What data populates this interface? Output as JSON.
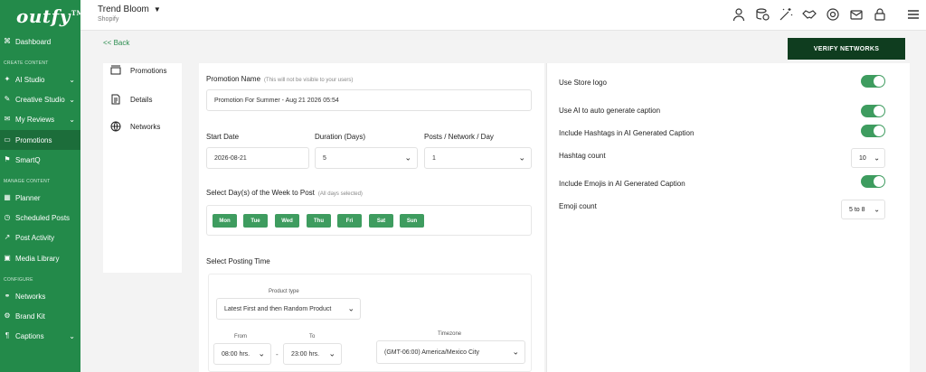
{
  "sidebar": {
    "logo": "outfy",
    "logo_tm": "TM",
    "sections": {
      "create": "CREATE CONTENT",
      "manage": "MANAGE CONTENT",
      "configure": "CONFIGURE"
    },
    "items": [
      {
        "label": "Dashboard",
        "icon": "grid-icon"
      },
      {
        "label": "AI Studio",
        "icon": "ai-icon"
      },
      {
        "label": "Creative Studio",
        "icon": "palette-icon"
      },
      {
        "label": "My Reviews",
        "icon": "chat-icon"
      },
      {
        "label": "Promotions",
        "icon": "promo-icon"
      },
      {
        "label": "SmartQ",
        "icon": "smartq-icon"
      },
      {
        "label": "Planner",
        "icon": "calendar-icon"
      },
      {
        "label": "Scheduled Posts",
        "icon": "clock-icon"
      },
      {
        "label": "Post Activity",
        "icon": "activity-icon"
      },
      {
        "label": "Media Library",
        "icon": "image-icon"
      },
      {
        "label": "Networks",
        "icon": "network-icon"
      },
      {
        "label": "Brand Kit",
        "icon": "brandkit-icon"
      },
      {
        "label": "Captions",
        "icon": "caption-icon"
      }
    ]
  },
  "header": {
    "store_name": "Trend Bloom",
    "platform": "Shopify"
  },
  "nav": {
    "back": "<< Back",
    "verify": "VERIFY NETWORKS"
  },
  "leftnav": {
    "items": [
      "Promotions",
      "Details",
      "Networks"
    ]
  },
  "form": {
    "promotion_name_label": "Promotion Name",
    "promotion_name_hint": "(This will not be visible to your users)",
    "promotion_name_value": "Promotion For Summer - Aug 21 2026 05:54",
    "start_date_label": "Start Date",
    "start_date_value": "2026-08-21",
    "duration_label": "Duration (Days)",
    "duration_value": "5",
    "posts_label": "Posts / Network / Day",
    "posts_value": "1",
    "days_label": "Select Day(s) of the Week to Post",
    "days_hint": "(All days selected)",
    "days": [
      "Mon",
      "Tue",
      "Wed",
      "Thu",
      "Fri",
      "Sat",
      "Sun"
    ],
    "posting_time_label": "Select Posting Time",
    "product_type_label": "Product type",
    "product_type_value": "Latest First and then Random Product",
    "from_label": "From",
    "from_value": "08:00 hrs.",
    "dash": "-",
    "to_label": "To",
    "to_value": "23:00 hrs.",
    "timezone_label": "Timezone",
    "timezone_value": "(GMT-06:00) America/Mexico City"
  },
  "settings": {
    "use_store_logo": "Use Store logo",
    "use_ai": "Use AI to auto generate caption",
    "include_hashtags": "Include Hashtags in AI Generated Caption",
    "hashtag_count_label": "Hashtag count",
    "hashtag_count_value": "10",
    "include_emojis": "Include Emojis in AI Generated Caption",
    "emoji_count_label": "Emoji count",
    "emoji_count_value": "5 to 8"
  },
  "colors": {
    "sidebar": "#238a4a",
    "accent": "#3e9c5f",
    "verify": "#0f3d1f"
  }
}
